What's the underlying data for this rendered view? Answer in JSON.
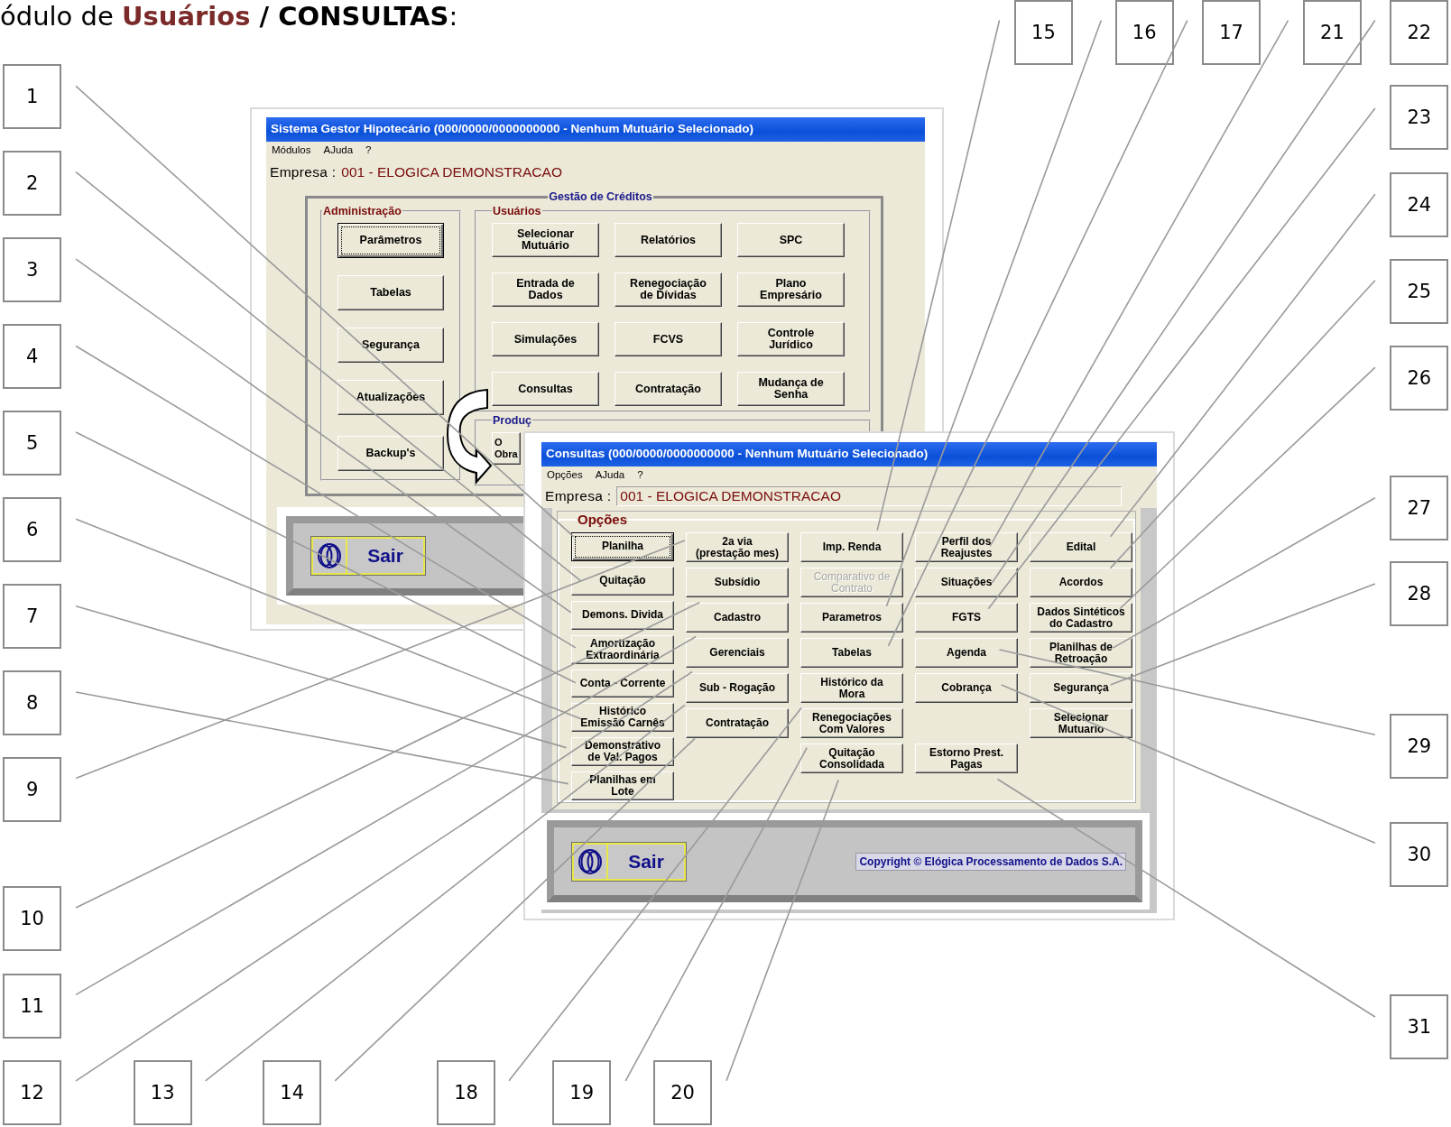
{
  "heading": {
    "parts": [
      "ódulo de ",
      "Usuários",
      " / CONSULTAS",
      ":"
    ]
  },
  "main_window": {
    "title": "Sistema Gestor Hipotecário (000/0000/0000000000 - Nenhum Mutuário Selecionado)",
    "menu": [
      "Módulos",
      "AJuda",
      "?"
    ],
    "company_label": "Empresa :",
    "company": "001 - ELOGICA DEMONSTRACAO",
    "group_title": "Gestão de Créditos",
    "admin": {
      "title": "Administração",
      "buttons": [
        {
          "label": "Parâmetros",
          "focused": true
        },
        {
          "label": "Tabelas",
          "focused": false
        },
        {
          "label": "Segurança",
          "focused": false
        },
        {
          "label": "Atualizações",
          "focused": false
        },
        {
          "label": "Backup's",
          "focused": false
        }
      ]
    },
    "users": {
      "title": "Usuários",
      "buttons": [
        {
          "label": "Selecionar\nMutuário",
          "focused": false
        },
        {
          "label": "Relatórios",
          "focused": false
        },
        {
          "label": "SPC",
          "focused": false
        },
        {
          "label": "Entrada de\nDados",
          "focused": false
        },
        {
          "label": "Renegociação\nde Dívidas",
          "focused": false
        },
        {
          "label": "Plano\nEmpresário",
          "focused": false
        },
        {
          "label": "Simulações",
          "focused": false
        },
        {
          "label": "FCVS",
          "focused": false
        },
        {
          "label": "Controle\nJurídico",
          "focused": false
        },
        {
          "label": "Consultas",
          "focused": false
        },
        {
          "label": "Contratação",
          "focused": false
        },
        {
          "label": "Mudança de\nSenha",
          "focused": false
        }
      ]
    },
    "production": {
      "title": "Produç",
      "button": "O\nObra"
    },
    "exit_button": "Sair"
  },
  "query_window": {
    "title": "Consultas (000/0000/0000000000 - Nenhum Mutuário Selecionado)",
    "menu": [
      "Opções",
      "AJuda",
      "?"
    ],
    "company_label": "Empresa :",
    "company": "001 - ELOGICA DEMONSTRACAO",
    "group_title": "Opções",
    "columns": [
      {
        "buttons": [
          {
            "label": "Planilha",
            "focused": true,
            "disabled": false,
            "gap_before": false
          },
          {
            "label": "Quitação",
            "focused": false,
            "disabled": false,
            "gap_before": false
          },
          {
            "label": "Demons. Divida",
            "focused": false,
            "disabled": false,
            "gap_before": false
          },
          {
            "label": "Amortização\nExtraordinária",
            "focused": false,
            "disabled": false,
            "gap_before": false
          },
          {
            "label": "Conta - Corrente",
            "focused": false,
            "disabled": false,
            "gap_before": false
          },
          {
            "label": "Histórico\nEmissão Carnês",
            "focused": false,
            "disabled": false,
            "gap_before": false
          },
          {
            "label": "Demonstrativo\nde Val. Pagos",
            "focused": false,
            "disabled": false,
            "gap_before": false
          },
          {
            "label": "Planilhas em\nLote",
            "focused": false,
            "disabled": false,
            "gap_before": false
          }
        ]
      },
      {
        "buttons": [
          {
            "label": "2a via\n(prestação mes)",
            "focused": false,
            "disabled": false,
            "gap_before": false
          },
          {
            "label": "Subsídio",
            "focused": false,
            "disabled": false,
            "gap_before": false
          },
          {
            "label": "Cadastro",
            "focused": false,
            "disabled": false,
            "gap_before": false
          },
          {
            "label": "Gerenciais",
            "focused": false,
            "disabled": false,
            "gap_before": false
          },
          {
            "label": "Sub - Rogação",
            "focused": false,
            "disabled": false,
            "gap_before": false
          },
          {
            "label": "Contratação",
            "focused": false,
            "disabled": false,
            "gap_before": false
          }
        ]
      },
      {
        "buttons": [
          {
            "label": "Imp. Renda",
            "focused": false,
            "disabled": false,
            "gap_before": false
          },
          {
            "label": "Comparativo de\nContrato",
            "focused": false,
            "disabled": true,
            "gap_before": false
          },
          {
            "label": "Parametros",
            "focused": false,
            "disabled": false,
            "gap_before": false
          },
          {
            "label": "Tabelas",
            "focused": false,
            "disabled": false,
            "gap_before": false
          },
          {
            "label": "Histórico da\nMora",
            "focused": false,
            "disabled": false,
            "gap_before": false
          },
          {
            "label": "Renegociações\nCom Valores",
            "focused": false,
            "disabled": false,
            "gap_before": false
          },
          {
            "label": "Quitação\nConsolidada",
            "focused": false,
            "disabled": false,
            "gap_before": false
          }
        ]
      },
      {
        "buttons": [
          {
            "label": "Perfil dos\nReajustes",
            "focused": false,
            "disabled": false,
            "gap_before": false
          },
          {
            "label": "Situações",
            "focused": false,
            "disabled": false,
            "gap_before": false
          },
          {
            "label": "FGTS",
            "focused": false,
            "disabled": false,
            "gap_before": false
          },
          {
            "label": "Agenda",
            "focused": false,
            "disabled": false,
            "gap_before": false
          },
          {
            "label": "Cobrança",
            "focused": false,
            "disabled": false,
            "gap_before": false
          },
          {
            "label": "Estorno Prest.\nPagas",
            "focused": false,
            "disabled": false,
            "gap_before": true
          }
        ]
      },
      {
        "buttons": [
          {
            "label": "Edital",
            "focused": false,
            "disabled": false,
            "gap_before": false
          },
          {
            "label": "Acordos",
            "focused": false,
            "disabled": false,
            "gap_before": false
          },
          {
            "label": "Dados Sintéticos\ndo Cadastro",
            "focused": false,
            "disabled": false,
            "gap_before": false
          },
          {
            "label": "Planilhas de\nRetroação",
            "focused": false,
            "disabled": false,
            "gap_before": false
          },
          {
            "label": "Segurança",
            "focused": false,
            "disabled": false,
            "gap_before": false
          },
          {
            "label": "Selecionar\nMutuario",
            "focused": false,
            "disabled": false,
            "gap_before": false
          }
        ]
      }
    ],
    "exit_button": "Sair",
    "copyright": "Copyright © Elógica Processamento de Dados S.A."
  },
  "callouts": [
    {
      "label": "1"
    },
    {
      "label": "2"
    },
    {
      "label": "3"
    },
    {
      "label": "4"
    },
    {
      "label": "5"
    },
    {
      "label": "6"
    },
    {
      "label": "7"
    },
    {
      "label": "8"
    },
    {
      "label": "9"
    },
    {
      "label": "10"
    },
    {
      "label": "11"
    },
    {
      "label": "12"
    },
    {
      "label": "13"
    },
    {
      "label": "14"
    },
    {
      "label": "15"
    },
    {
      "label": "16"
    },
    {
      "label": "17"
    },
    {
      "label": "18"
    },
    {
      "label": "19"
    },
    {
      "label": "20"
    },
    {
      "label": "21"
    },
    {
      "label": "22"
    },
    {
      "label": "23"
    },
    {
      "label": "24"
    },
    {
      "label": "25"
    },
    {
      "label": "26"
    },
    {
      "label": "27"
    },
    {
      "label": "28"
    },
    {
      "label": "29"
    },
    {
      "label": "30"
    },
    {
      "label": "31"
    }
  ]
}
